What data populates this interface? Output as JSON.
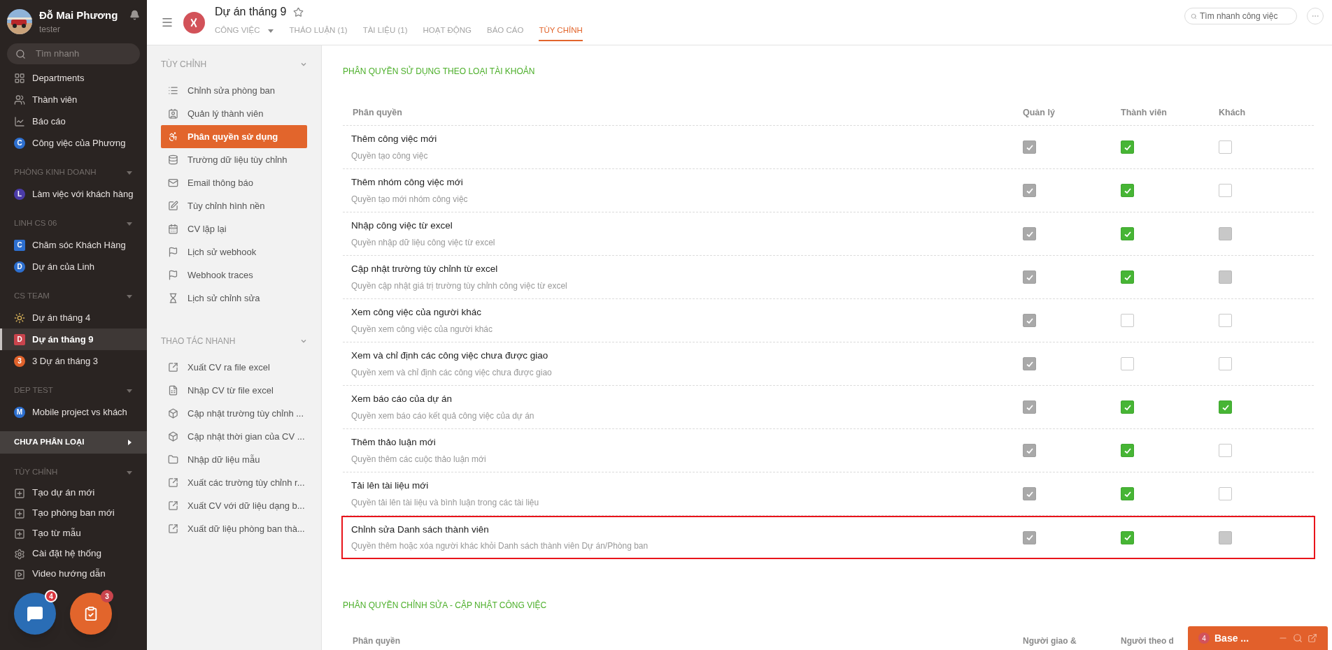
{
  "sidebar": {
    "user": {
      "name": "Đỗ Mai Phương",
      "role": "tester"
    },
    "search": {
      "placeholder": "Tìm nhanh"
    },
    "groups": [
      {
        "items": [
          {
            "kind": "departments",
            "label": "Departments",
            "selected": false
          },
          {
            "kind": "members",
            "label": "Thành viên",
            "selected": false
          },
          {
            "kind": "report",
            "label": "Báo cáo",
            "selected": false
          },
          {
            "kind": "circle",
            "letter": "C",
            "color": "#2d6fcf",
            "label": "Công việc của Phương",
            "selected": false
          }
        ]
      },
      {
        "title": "PHÒNG KINH DOANH",
        "items": [
          {
            "kind": "circle",
            "letter": "L",
            "color": "#4b3ba8",
            "label": "Làm việc với khách hàng",
            "selected": false
          }
        ]
      },
      {
        "title": "LINH CS 06",
        "items": [
          {
            "kind": "square",
            "letter": "C",
            "color": "#2d6fcf",
            "label": "Chăm sóc Khách Hàng",
            "selected": false
          },
          {
            "kind": "circle",
            "letter": "D",
            "color": "#2d6fcf",
            "label": "Dự án của Linh",
            "selected": false
          }
        ]
      },
      {
        "title": "CS TEAM",
        "items": [
          {
            "kind": "sun",
            "label": "Dự án tháng 4",
            "selected": false
          },
          {
            "kind": "square",
            "letter": "D",
            "color": "#c9444d",
            "label": "Dự án tháng 9",
            "selected": true
          },
          {
            "kind": "circle",
            "letter": "3",
            "color": "#e0622b",
            "label": "3 Dự án tháng 3",
            "selected": false
          }
        ]
      },
      {
        "title": "DEP TEST",
        "items": [
          {
            "kind": "circle",
            "letter": "M",
            "color": "#2d6fcf",
            "label": "Mobile project vs khách",
            "selected": false
          }
        ]
      }
    ],
    "uncategorized": {
      "label": "CHƯA PHÂN LOẠI"
    },
    "settings": {
      "title": "TÙY CHỈNH",
      "items": [
        {
          "kind": "plus",
          "label": "Tạo dự án mới"
        },
        {
          "kind": "plus",
          "label": "Tạo phòng ban mới"
        },
        {
          "kind": "plus",
          "label": "Tạo từ mẫu"
        },
        {
          "kind": "gear",
          "label": "Cài đặt hệ thống"
        },
        {
          "kind": "video",
          "label": "Video hướng dẫn"
        }
      ]
    },
    "fabs": [
      {
        "kind": "chat",
        "badge": "4"
      },
      {
        "kind": "tasks",
        "badge": "3"
      }
    ]
  },
  "header": {
    "project": "Dự án tháng 9",
    "search": {
      "placeholder": "Tìm nhanh công việc"
    },
    "tabs": [
      {
        "label": "CÔNG VIỆC",
        "selected": false,
        "menu": true
      },
      {
        "label": "THẢO LUẬN (1)",
        "selected": false,
        "menu": false
      },
      {
        "label": "TÀI LIỆU (1)",
        "selected": false,
        "menu": false
      },
      {
        "label": "HOẠT ĐỘNG",
        "selected": false,
        "menu": false
      },
      {
        "label": "BÁO CÁO",
        "selected": false,
        "menu": false
      },
      {
        "label": "TÙY CHỈNH",
        "selected": true,
        "menu": false
      }
    ]
  },
  "settings_panel": [
    {
      "title": "TÙY CHỈNH",
      "items": [
        {
          "kind": "list",
          "label": "Chỉnh sửa phòng ban",
          "selected": false
        },
        {
          "kind": "contact",
          "label": "Quản lý thành viên",
          "selected": false
        },
        {
          "kind": "permission",
          "label": "Phân quyền sử dụng",
          "selected": true
        },
        {
          "kind": "database",
          "label": "Trường dữ liệu tùy chỉnh",
          "selected": false
        },
        {
          "kind": "mail",
          "label": "Email thông báo",
          "selected": false
        },
        {
          "kind": "edit",
          "label": "Tùy chỉnh hình nền",
          "selected": false
        },
        {
          "kind": "calendar",
          "label": "CV lặp lại",
          "selected": false
        },
        {
          "kind": "flag",
          "label": "Lịch sử webhook",
          "selected": false
        },
        {
          "kind": "flag",
          "label": "Webhook traces",
          "selected": false
        },
        {
          "kind": "hourglass",
          "label": "Lịch sử chỉnh sửa",
          "selected": false
        }
      ]
    },
    {
      "title": "THAO TÁC NHANH",
      "items": [
        {
          "kind": "export",
          "label": "Xuất CV ra file excel",
          "selected": false
        },
        {
          "kind": "excel",
          "label": "Nhập CV từ file excel",
          "selected": false
        },
        {
          "kind": "cube",
          "label": "Cập nhật trường tùy chỉnh ...",
          "selected": false
        },
        {
          "kind": "cube",
          "label": "Cập nhật thời gian của CV ...",
          "selected": false
        },
        {
          "kind": "folder",
          "label": "Nhập dữ liệu mẫu",
          "selected": false
        },
        {
          "kind": "export",
          "label": "Xuất các trường tùy chỉnh r...",
          "selected": false
        },
        {
          "kind": "export",
          "label": "Xuất CV với dữ liệu dạng b...",
          "selected": false
        },
        {
          "kind": "export",
          "label": "Xuất dữ liệu phòng ban thà...",
          "selected": false
        }
      ]
    }
  ],
  "section_1": {
    "title": "PHÂN QUYỀN SỬ DỤNG THEO LOẠI TÀI KHOẢN",
    "columns": [
      "Phân quyền",
      "Quản lý",
      "Thành viên",
      "Khách"
    ],
    "rows": [
      {
        "title": "Thêm công việc mới",
        "description": "Quyền tạo công việc",
        "highlighted": false,
        "cells": [
          {
            "checked": true,
            "disabled": true
          },
          {
            "checked": true,
            "disabled": false
          },
          {
            "checked": false,
            "disabled": false
          }
        ]
      },
      {
        "title": "Thêm nhóm công việc mới",
        "description": "Quyền tạo mới nhóm công việc",
        "highlighted": false,
        "cells": [
          {
            "checked": true,
            "disabled": true
          },
          {
            "checked": true,
            "disabled": false
          },
          {
            "checked": false,
            "disabled": false
          }
        ]
      },
      {
        "title": "Nhập công việc từ excel",
        "description": "Quyền nhập dữ liệu công việc từ excel",
        "highlighted": false,
        "cells": [
          {
            "checked": true,
            "disabled": true
          },
          {
            "checked": true,
            "disabled": false
          },
          {
            "checked": false,
            "disabled": true
          }
        ]
      },
      {
        "title": "Cập nhật trường tùy chỉnh từ excel",
        "description": "Quyền cập nhật giá trị trường tùy chỉnh công việc từ excel",
        "highlighted": false,
        "cells": [
          {
            "checked": true,
            "disabled": true
          },
          {
            "checked": true,
            "disabled": false
          },
          {
            "checked": false,
            "disabled": true
          }
        ]
      },
      {
        "title": "Xem công việc của người khác",
        "description": "Quyền xem công việc của người khác",
        "highlighted": false,
        "cells": [
          {
            "checked": true,
            "disabled": true
          },
          {
            "checked": false,
            "disabled": false
          },
          {
            "checked": false,
            "disabled": false
          }
        ]
      },
      {
        "title": "Xem và chỉ định các công việc chưa được giao",
        "description": "Quyền xem và chỉ định các công việc chưa được giao",
        "highlighted": false,
        "cells": [
          {
            "checked": true,
            "disabled": true
          },
          {
            "checked": false,
            "disabled": false
          },
          {
            "checked": false,
            "disabled": false
          }
        ]
      },
      {
        "title": "Xem báo cáo của dự án",
        "description": "Quyền xem báo cáo kết quả công việc của dự án",
        "highlighted": false,
        "cells": [
          {
            "checked": true,
            "disabled": true
          },
          {
            "checked": true,
            "disabled": false
          },
          {
            "checked": true,
            "disabled": false
          }
        ]
      },
      {
        "title": "Thêm thảo luận mới",
        "description": "Quyền thêm các cuộc thảo luận mới",
        "highlighted": false,
        "cells": [
          {
            "checked": true,
            "disabled": true
          },
          {
            "checked": true,
            "disabled": false
          },
          {
            "checked": false,
            "disabled": false
          }
        ]
      },
      {
        "title": "Tải lên tài liệu mới",
        "description": "Quyền tải lên tài liệu và bình luận trong các tài liệu",
        "highlighted": false,
        "cells": [
          {
            "checked": true,
            "disabled": true
          },
          {
            "checked": true,
            "disabled": false
          },
          {
            "checked": false,
            "disabled": false
          }
        ]
      },
      {
        "title": "Chỉnh sửa Danh sách thành viên",
        "description": "Quyền thêm hoặc xóa người khác khỏi Danh sách thành viên Dự án/Phòng ban",
        "highlighted": true,
        "cells": [
          {
            "checked": true,
            "disabled": true
          },
          {
            "checked": true,
            "disabled": false
          },
          {
            "checked": false,
            "disabled": true
          }
        ]
      }
    ]
  },
  "section_2": {
    "title": "PHÂN QUYỀN CHỈNH SỬA - CẬP NHẬT CÔNG VIỆC",
    "columns": [
      "Phân quyền",
      "Người giao &",
      "Người theo d"
    ]
  },
  "chat_widget": {
    "badge": "4",
    "title": "Base ..."
  }
}
